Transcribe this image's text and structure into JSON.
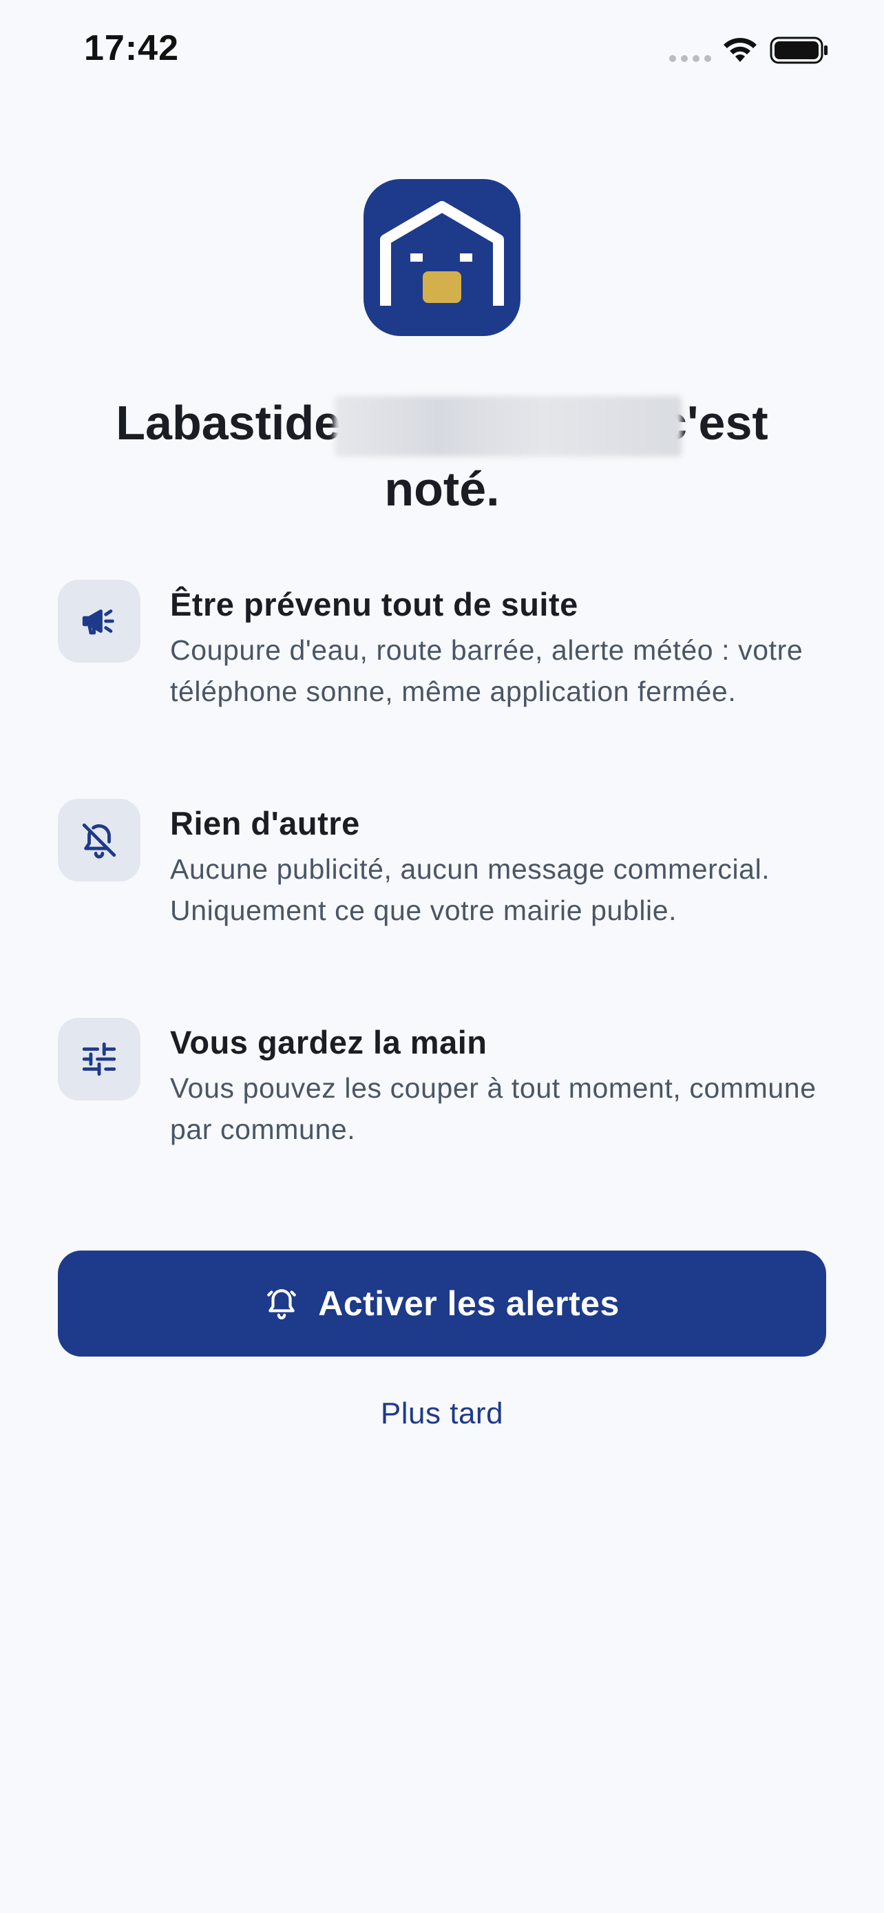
{
  "status_bar": {
    "time": "17:42"
  },
  "logo": {
    "icon": "house-face-logo",
    "background": "#1e3a8a",
    "accent": "#d4b04c"
  },
  "title": {
    "text": "Labastide-d'Armagnac, c'est noté."
  },
  "features": [
    {
      "icon": "megaphone-icon",
      "title": "Être prévenu tout de suite",
      "description": "Coupure d'eau, route barrée, alerte météo : votre téléphone sonne, même application fermée."
    },
    {
      "icon": "bell-off-icon",
      "title": "Rien d'autre",
      "description": "Aucune publicité, aucun message commercial. Uniquement ce que votre mairie publie."
    },
    {
      "icon": "sliders-icon",
      "title": "Vous gardez la main",
      "description": "Vous pouvez les couper à tout moment, commune par commune."
    }
  ],
  "actions": {
    "primary_label": "Activer les alertes",
    "primary_icon": "bell-ring-icon",
    "secondary_label": "Plus tard"
  },
  "colors": {
    "brand": "#1e3a8a",
    "background": "#f7f9fc",
    "icon_tile": "#e3e7ef",
    "body_text": "#4a5565"
  }
}
